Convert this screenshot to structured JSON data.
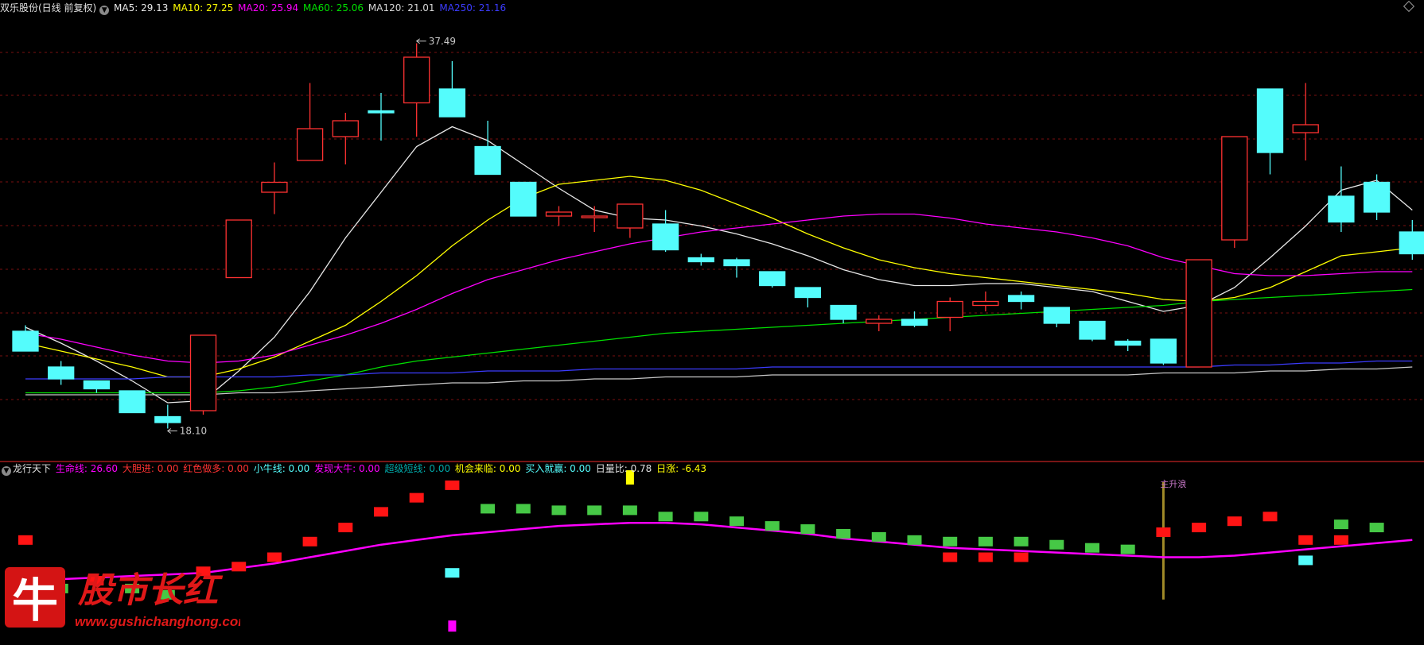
{
  "colors": {
    "up": "#ff3232",
    "down": "#54fcfc",
    "ma5": "#e8e8e8",
    "ma10": "#ffff00",
    "ma20": "#ff00ff",
    "ma60": "#00e000",
    "ma120": "#c8c8c8",
    "ma250": "#3c3cff",
    "divider": "#a01c1c",
    "grid": "#7a1010"
  },
  "header": {
    "stock": "双乐股份(日线 前复权)",
    "toggle_icon": "chevron-down-icon",
    "ma5": "MA5: 29.13",
    "ma10": "MA10: 27.25",
    "ma20": "MA20: 25.94",
    "ma60": "MA60: 25.06",
    "ma120": "MA120: 21.01",
    "ma250": "MA250: 21.16"
  },
  "indicator": {
    "name": "龙行天下",
    "l1": "生命线: 26.60",
    "l2": "大胆进: 0.00",
    "l3": "红色做多: 0.00",
    "l4": "小牛线: 0.00",
    "l5": "发现大牛: 0.00",
    "l6": "超级短线: 0.00",
    "l7": "机会来临: 0.00",
    "l8": "买入就赢: 0.00",
    "l9": "日量比: 0.78",
    "l10": "日涨: -6.43",
    "annotation": "主升浪"
  },
  "watermark": {
    "glyph": "牛",
    "title": "股市长红",
    "url": "www.gushichanghong.com"
  },
  "chart_data": {
    "type": "candlestick",
    "price_axis": [
      17.0,
      38.8
    ],
    "annotations": [
      {
        "index": 11,
        "value": 37.49,
        "label": "37.49"
      },
      {
        "index": 4,
        "value": 18.1,
        "label": "18.10"
      }
    ],
    "candles": [
      {
        "o": 23.0,
        "h": 23.3,
        "l": 22.0,
        "c": 22.0
      },
      {
        "o": 21.2,
        "h": 21.5,
        "l": 20.3,
        "c": 20.6
      },
      {
        "o": 20.5,
        "h": 20.5,
        "l": 19.9,
        "c": 20.1
      },
      {
        "o": 20.0,
        "h": 20.0,
        "l": 18.9,
        "c": 18.9
      },
      {
        "o": 18.7,
        "h": 19.3,
        "l": 18.1,
        "c": 18.4
      },
      {
        "o": 19.0,
        "h": 22.8,
        "l": 18.8,
        "c": 22.8
      },
      {
        "o": 25.7,
        "h": 28.6,
        "l": 25.7,
        "c": 28.6
      },
      {
        "o": 30.0,
        "h": 31.5,
        "l": 28.9,
        "c": 30.5
      },
      {
        "o": 31.6,
        "h": 35.5,
        "l": 31.6,
        "c": 33.2
      },
      {
        "o": 32.8,
        "h": 34.0,
        "l": 31.4,
        "c": 33.6
      },
      {
        "o": 34.1,
        "h": 35.0,
        "l": 32.6,
        "c": 34.0
      },
      {
        "o": 34.5,
        "h": 37.5,
        "l": 32.8,
        "c": 36.8
      },
      {
        "o": 35.2,
        "h": 36.6,
        "l": 33.8,
        "c": 33.8
      },
      {
        "o": 32.3,
        "h": 33.6,
        "l": 30.9,
        "c": 30.9
      },
      {
        "o": 30.5,
        "h": 30.5,
        "l": 28.8,
        "c": 28.8
      },
      {
        "o": 28.8,
        "h": 29.3,
        "l": 28.3,
        "c": 29.0
      },
      {
        "o": 28.8,
        "h": 29.3,
        "l": 28.0,
        "c": 28.8
      },
      {
        "o": 28.2,
        "h": 29.4,
        "l": 27.7,
        "c": 29.4
      },
      {
        "o": 28.4,
        "h": 29.1,
        "l": 27.0,
        "c": 27.1
      },
      {
        "o": 26.7,
        "h": 26.9,
        "l": 26.3,
        "c": 26.5
      },
      {
        "o": 26.6,
        "h": 26.7,
        "l": 25.7,
        "c": 26.3
      },
      {
        "o": 26.0,
        "h": 26.0,
        "l": 25.2,
        "c": 25.3
      },
      {
        "o": 25.2,
        "h": 25.2,
        "l": 24.2,
        "c": 24.7
      },
      {
        "o": 24.3,
        "h": 24.3,
        "l": 23.4,
        "c": 23.6
      },
      {
        "o": 23.4,
        "h": 23.8,
        "l": 23.0,
        "c": 23.6
      },
      {
        "o": 23.6,
        "h": 24.0,
        "l": 23.2,
        "c": 23.3
      },
      {
        "o": 23.7,
        "h": 24.7,
        "l": 23.0,
        "c": 24.5
      },
      {
        "o": 24.3,
        "h": 25.0,
        "l": 24.0,
        "c": 24.5
      },
      {
        "o": 24.8,
        "h": 25.0,
        "l": 24.1,
        "c": 24.5
      },
      {
        "o": 24.2,
        "h": 24.2,
        "l": 23.2,
        "c": 23.4
      },
      {
        "o": 23.5,
        "h": 23.5,
        "l": 22.5,
        "c": 22.6
      },
      {
        "o": 22.5,
        "h": 22.6,
        "l": 22.0,
        "c": 22.3
      },
      {
        "o": 22.6,
        "h": 22.6,
        "l": 21.3,
        "c": 21.4
      },
      {
        "o": 21.2,
        "h": 26.6,
        "l": 21.2,
        "c": 26.6
      },
      {
        "o": 27.6,
        "h": 32.8,
        "l": 27.2,
        "c": 32.8
      },
      {
        "o": 35.2,
        "h": 35.2,
        "l": 30.9,
        "c": 32.0
      },
      {
        "o": 33.0,
        "h": 35.5,
        "l": 31.6,
        "c": 33.4
      },
      {
        "o": 29.8,
        "h": 31.3,
        "l": 28.0,
        "c": 28.5
      },
      {
        "o": 30.5,
        "h": 30.9,
        "l": 28.6,
        "c": 29.0
      },
      {
        "o": 28.0,
        "h": 28.6,
        "l": 26.6,
        "c": 26.9
      }
    ],
    "series": [
      {
        "name": "MA5",
        "color": "ma5",
        "values": [
          23.2,
          22.4,
          21.5,
          20.5,
          19.4,
          19.5,
          21.0,
          22.7,
          25.0,
          27.7,
          30.0,
          32.3,
          33.3,
          32.6,
          31.4,
          30.2,
          29.1,
          28.7,
          28.6,
          28.3,
          27.9,
          27.4,
          26.8,
          26.1,
          25.6,
          25.3,
          25.3,
          25.4,
          25.4,
          25.2,
          25.0,
          24.5,
          24.0,
          24.3,
          25.2,
          26.7,
          28.3,
          30.1,
          30.6,
          29.1
        ]
      },
      {
        "name": "MA10",
        "color": "ma10",
        "values": [
          22.4,
          22.0,
          21.6,
          21.2,
          20.7,
          20.7,
          21.1,
          21.7,
          22.5,
          23.3,
          24.5,
          25.8,
          27.3,
          28.6,
          29.7,
          30.4,
          30.6,
          30.8,
          30.6,
          30.1,
          29.4,
          28.7,
          27.9,
          27.2,
          26.6,
          26.2,
          25.9,
          25.7,
          25.5,
          25.3,
          25.1,
          24.9,
          24.6,
          24.5,
          24.7,
          25.2,
          26.0,
          26.8,
          27.0,
          27.2
        ]
      },
      {
        "name": "MA20",
        "color": "ma20",
        "values": [
          22.9,
          22.6,
          22.2,
          21.8,
          21.5,
          21.4,
          21.5,
          21.8,
          22.3,
          22.8,
          23.4,
          24.1,
          24.9,
          25.6,
          26.1,
          26.6,
          27.0,
          27.4,
          27.7,
          28.0,
          28.2,
          28.4,
          28.6,
          28.8,
          28.9,
          28.9,
          28.7,
          28.4,
          28.2,
          28.0,
          27.7,
          27.3,
          26.7,
          26.3,
          25.9,
          25.8,
          25.8,
          25.9,
          26.0,
          26.0
        ]
      },
      {
        "name": "MA60",
        "color": "ma60",
        "values": [
          19.9,
          19.9,
          19.9,
          19.9,
          19.9,
          19.9,
          20.0,
          20.2,
          20.5,
          20.8,
          21.2,
          21.5,
          21.7,
          21.9,
          22.1,
          22.3,
          22.5,
          22.7,
          22.9,
          23.0,
          23.1,
          23.2,
          23.3,
          23.4,
          23.5,
          23.6,
          23.7,
          23.8,
          23.9,
          24.0,
          24.1,
          24.2,
          24.3,
          24.5,
          24.6,
          24.7,
          24.8,
          24.9,
          25.0,
          25.1
        ]
      },
      {
        "name": "MA120",
        "color": "ma120",
        "values": [
          19.8,
          19.8,
          19.8,
          19.8,
          19.8,
          19.8,
          19.9,
          19.9,
          20.0,
          20.1,
          20.2,
          20.3,
          20.4,
          20.4,
          20.5,
          20.5,
          20.6,
          20.6,
          20.7,
          20.7,
          20.7,
          20.8,
          20.8,
          20.8,
          20.8,
          20.8,
          20.8,
          20.8,
          20.8,
          20.8,
          20.8,
          20.8,
          20.9,
          20.9,
          20.9,
          21.0,
          21.0,
          21.1,
          21.1,
          21.2
        ]
      },
      {
        "name": "MA250",
        "color": "ma250",
        "values": [
          20.6,
          20.6,
          20.6,
          20.6,
          20.7,
          20.7,
          20.7,
          20.7,
          20.8,
          20.8,
          20.9,
          20.9,
          20.9,
          21.0,
          21.0,
          21.0,
          21.1,
          21.1,
          21.1,
          21.1,
          21.1,
          21.2,
          21.2,
          21.2,
          21.2,
          21.2,
          21.2,
          21.2,
          21.2,
          21.2,
          21.2,
          21.2,
          21.2,
          21.2,
          21.3,
          21.3,
          21.4,
          21.4,
          21.5,
          21.5
        ]
      }
    ],
    "lower": {
      "range": [
        0,
        10
      ],
      "lifeline": [
        3.5,
        3.6,
        3.7,
        3.8,
        3.9,
        4.0,
        4.3,
        4.6,
        5.0,
        5.4,
        5.8,
        6.1,
        6.4,
        6.6,
        6.8,
        7.0,
        7.1,
        7.2,
        7.2,
        7.1,
        6.9,
        6.7,
        6.5,
        6.2,
        6.0,
        5.8,
        5.6,
        5.5,
        5.4,
        5.3,
        5.2,
        5.1,
        5.0,
        5.0,
        5.1,
        5.3,
        5.5,
        5.7,
        5.9,
        6.1
      ],
      "dashes": [
        {
          "i": 0,
          "v": 6.1,
          "k": "red"
        },
        {
          "i": 1,
          "v": 3.0,
          "k": "green"
        },
        {
          "i": 2,
          "v": 3.5,
          "k": "red"
        },
        {
          "i": 3,
          "v": 3.0,
          "k": "green"
        },
        {
          "i": 4,
          "v": 2.6,
          "k": "green"
        },
        {
          "i": 5,
          "v": 4.1,
          "k": "red"
        },
        {
          "i": 6,
          "v": 4.4,
          "k": "red"
        },
        {
          "i": 7,
          "v": 5.0,
          "k": "red"
        },
        {
          "i": 8,
          "v": 6.0,
          "k": "red"
        },
        {
          "i": 9,
          "v": 6.9,
          "k": "red"
        },
        {
          "i": 10,
          "v": 7.9,
          "k": "red"
        },
        {
          "i": 11,
          "v": 8.8,
          "k": "red"
        },
        {
          "i": 12,
          "v": 9.6,
          "k": "red"
        },
        {
          "i": 12,
          "v": 4.0,
          "k": "cyan"
        },
        {
          "i": 12,
          "v": 0.6,
          "k": "magenta"
        },
        {
          "i": 13,
          "v": 8.1,
          "k": "green"
        },
        {
          "i": 14,
          "v": 8.1,
          "k": "green"
        },
        {
          "i": 15,
          "v": 8.0,
          "k": "green"
        },
        {
          "i": 16,
          "v": 8.0,
          "k": "green"
        },
        {
          "i": 17,
          "v": 8.0,
          "k": "green"
        },
        {
          "i": 17,
          "v": 10.1,
          "k": "yellow"
        },
        {
          "i": 18,
          "v": 7.6,
          "k": "green"
        },
        {
          "i": 19,
          "v": 7.6,
          "k": "green"
        },
        {
          "i": 20,
          "v": 7.3,
          "k": "green"
        },
        {
          "i": 21,
          "v": 7.0,
          "k": "green"
        },
        {
          "i": 22,
          "v": 6.8,
          "k": "green"
        },
        {
          "i": 23,
          "v": 6.5,
          "k": "green"
        },
        {
          "i": 24,
          "v": 6.3,
          "k": "green"
        },
        {
          "i": 25,
          "v": 6.1,
          "k": "green"
        },
        {
          "i": 26,
          "v": 6.0,
          "k": "green"
        },
        {
          "i": 26,
          "v": 5.0,
          "k": "red"
        },
        {
          "i": 27,
          "v": 6.0,
          "k": "green"
        },
        {
          "i": 27,
          "v": 5.0,
          "k": "red"
        },
        {
          "i": 28,
          "v": 6.0,
          "k": "green"
        },
        {
          "i": 28,
          "v": 5.0,
          "k": "red"
        },
        {
          "i": 29,
          "v": 5.8,
          "k": "green"
        },
        {
          "i": 30,
          "v": 5.6,
          "k": "green"
        },
        {
          "i": 31,
          "v": 5.5,
          "k": "green"
        },
        {
          "i": 32,
          "v": 6.6,
          "k": "red"
        },
        {
          "i": 33,
          "v": 6.9,
          "k": "red"
        },
        {
          "i": 34,
          "v": 7.3,
          "k": "red"
        },
        {
          "i": 35,
          "v": 7.6,
          "k": "red"
        },
        {
          "i": 36,
          "v": 6.1,
          "k": "red"
        },
        {
          "i": 36,
          "v": 4.8,
          "k": "cyan"
        },
        {
          "i": 37,
          "v": 7.1,
          "k": "green"
        },
        {
          "i": 37,
          "v": 6.1,
          "k": "red"
        },
        {
          "i": 38,
          "v": 6.9,
          "k": "green"
        }
      ],
      "zsl_index": 32
    }
  }
}
